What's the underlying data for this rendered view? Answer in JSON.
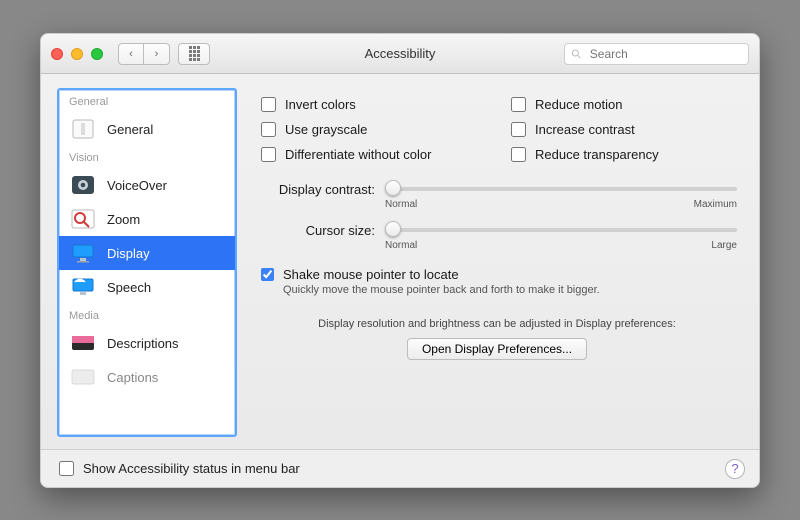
{
  "window": {
    "title": "Accessibility"
  },
  "toolbar": {
    "search_placeholder": "Search"
  },
  "sidebar": {
    "sections": [
      {
        "label": "General",
        "items": [
          {
            "label": "General"
          }
        ]
      },
      {
        "label": "Vision",
        "items": [
          {
            "label": "VoiceOver"
          },
          {
            "label": "Zoom"
          },
          {
            "label": "Display",
            "selected": true
          },
          {
            "label": "Speech"
          }
        ]
      },
      {
        "label": "Media",
        "items": [
          {
            "label": "Descriptions"
          },
          {
            "label": "Captions"
          }
        ]
      }
    ]
  },
  "detail": {
    "checkboxes": {
      "invert_colors": "Invert colors",
      "reduce_motion": "Reduce motion",
      "use_grayscale": "Use grayscale",
      "increase_contrast": "Increase contrast",
      "diff_without_color": "Differentiate without color",
      "reduce_transparency": "Reduce transparency"
    },
    "sliders": {
      "contrast": {
        "label": "Display contrast:",
        "min_label": "Normal",
        "max_label": "Maximum"
      },
      "cursor": {
        "label": "Cursor size:",
        "min_label": "Normal",
        "max_label": "Large"
      }
    },
    "shake": {
      "label": "Shake mouse pointer to locate",
      "sub": "Quickly move the mouse pointer back and forth to make it bigger.",
      "checked": true
    },
    "note": "Display resolution and brightness can be adjusted in Display preferences:",
    "open_button": "Open Display Preferences..."
  },
  "bottom": {
    "status_checkbox": "Show Accessibility status in menu bar"
  },
  "colors": {
    "accent": "#2a73ff"
  }
}
